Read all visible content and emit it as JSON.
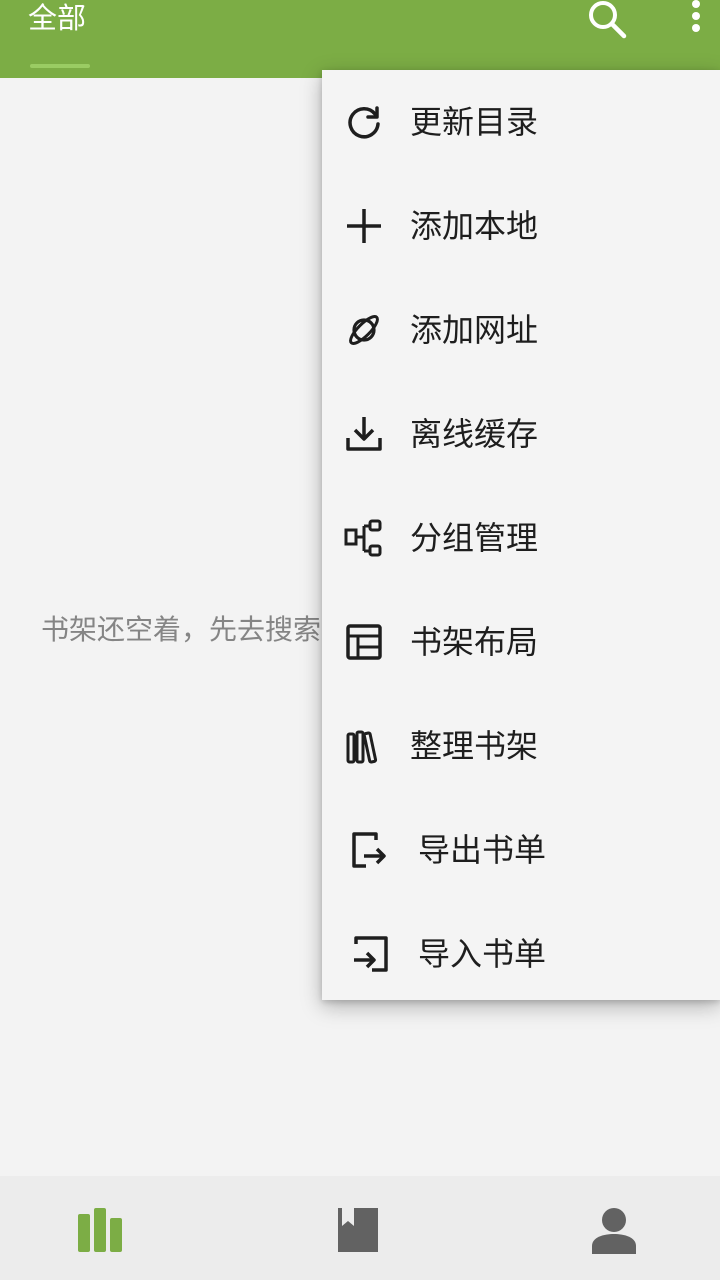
{
  "header": {
    "tab_all_label": "全部",
    "icons": [
      "search-icon",
      "more-vertical-icon"
    ]
  },
  "main": {
    "empty_message": "书架还空着，先去搜索"
  },
  "menu": {
    "items": [
      {
        "label": "更新目录",
        "icon": "refresh-icon"
      },
      {
        "label": "添加本地",
        "icon": "plus-icon"
      },
      {
        "label": "添加网址",
        "icon": "planet-icon"
      },
      {
        "label": "离线缓存",
        "icon": "download-icon"
      },
      {
        "label": "分组管理",
        "icon": "group-tree-icon"
      },
      {
        "label": "书架布局",
        "icon": "layout-icon"
      },
      {
        "label": "整理书架",
        "icon": "books-icon"
      },
      {
        "label": "导出书单",
        "icon": "export-icon"
      },
      {
        "label": "导入书单",
        "icon": "import-icon"
      }
    ]
  },
  "bottom_nav": {
    "items": [
      {
        "name": "bookshelf",
        "icon": "bookshelf-icon",
        "active": true
      },
      {
        "name": "discover",
        "icon": "bookmark-book-icon",
        "active": false
      },
      {
        "name": "my",
        "icon": "person-icon",
        "active": false
      }
    ]
  },
  "colors": {
    "primary": "#7cad45",
    "accent": "#9acc63",
    "nav_active": "#7cad45",
    "nav_inactive": "#626262",
    "background": "#f3f3f3"
  }
}
